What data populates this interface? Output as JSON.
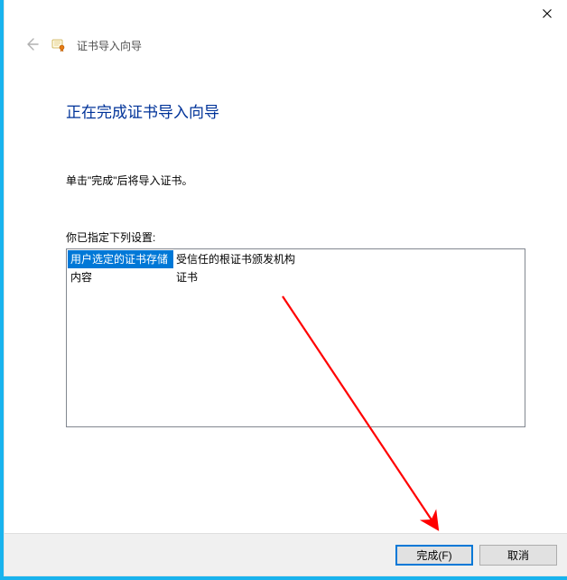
{
  "header": {
    "title": "证书导入向导"
  },
  "main": {
    "heading": "正在完成证书导入向导",
    "instruction": "单击\"完成\"后将导入证书。",
    "settings_label": "你已指定下列设置:"
  },
  "settings": {
    "rows": [
      {
        "key": "用户选定的证书存储",
        "value": "受信任的根证书颁发机构"
      },
      {
        "key": "内容",
        "value": "证书"
      }
    ]
  },
  "buttons": {
    "finish": "完成(F)",
    "cancel": "取消"
  }
}
